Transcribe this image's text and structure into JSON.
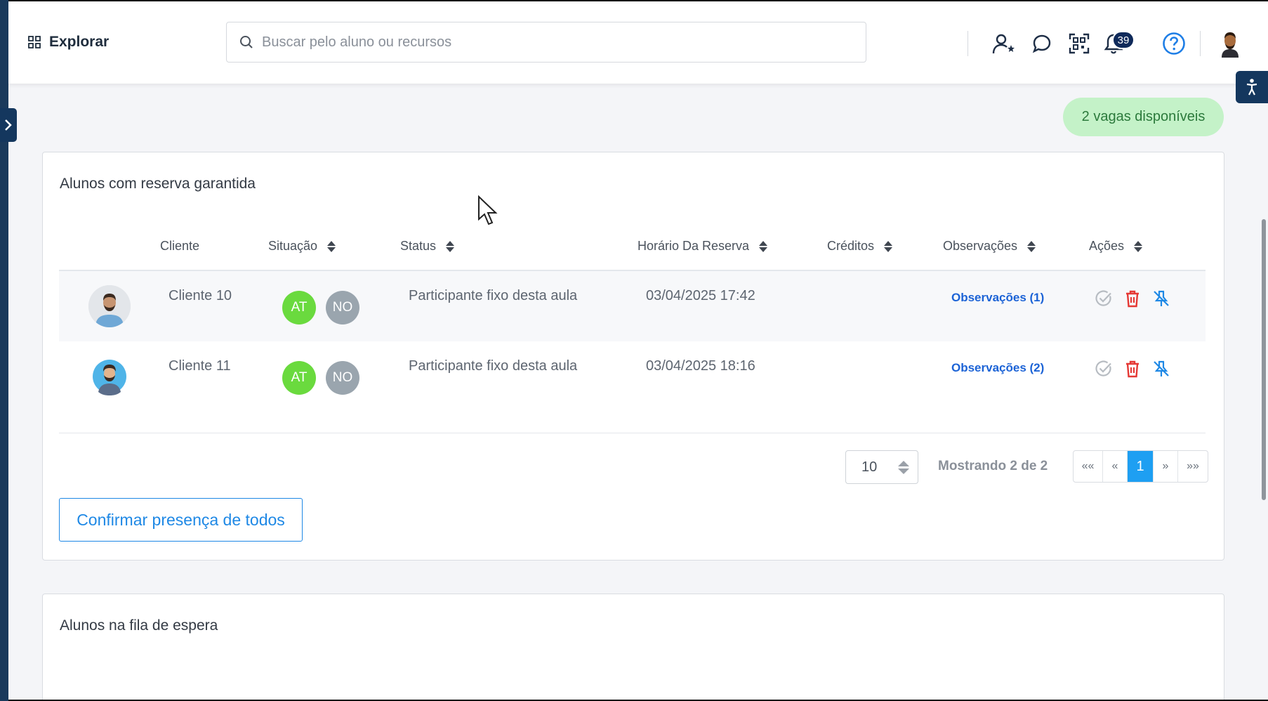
{
  "topbar": {
    "explore_label": "Explorar",
    "search_placeholder": "Buscar pelo aluno ou recursos",
    "notifications_count": "39"
  },
  "availability": "2 vagas disponíveis",
  "reserved": {
    "title": "Alunos com reserva garantida",
    "columns": [
      "Cliente",
      "Situação",
      "Status",
      "Horário Da Reserva",
      "Créditos",
      "Observações",
      "Ações"
    ],
    "rows": [
      {
        "client": "Cliente 10",
        "situation": [
          "AT",
          "NO"
        ],
        "status": "Participante fixo desta aula",
        "time": "03/04/2025 17:42",
        "credits": "",
        "observations": "Observações (1)"
      },
      {
        "client": "Cliente 11",
        "situation": [
          "AT",
          "NO"
        ],
        "status": "Participante fixo desta aula",
        "time": "03/04/2025 18:16",
        "credits": "",
        "observations": "Observações (2)"
      }
    ],
    "page_size": "10",
    "showing": "Mostrando 2 de 2",
    "pagination": [
      "««",
      "«",
      "1",
      "»",
      "»»"
    ],
    "confirm_all": "Confirmar presença de todos"
  },
  "waitlist": {
    "title": "Alunos na fila de espera"
  },
  "colors": {
    "primary": "#1e88e5",
    "active_page": "#1e9ff2",
    "at_badge": "#6ada3e",
    "no_badge": "#9aa5ae",
    "delete": "#e53935",
    "vagas_bg": "#c4f2c8",
    "vagas_text": "#2c7a3c",
    "nav_dark": "#14375e"
  }
}
